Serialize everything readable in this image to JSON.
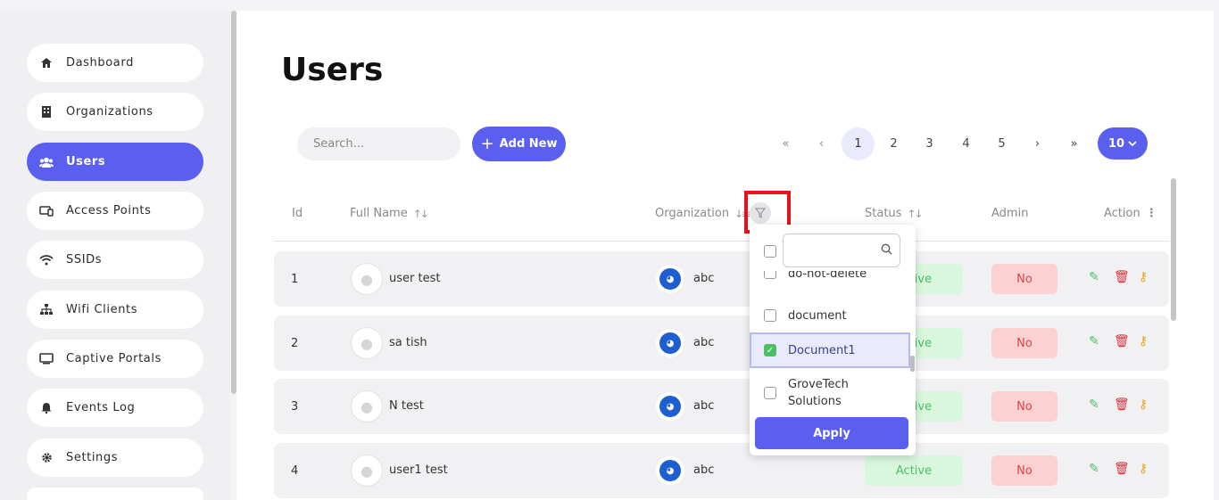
{
  "sidebar": {
    "items": [
      {
        "label": "Dashboard",
        "icon": "home-icon"
      },
      {
        "label": "Organizations",
        "icon": "building-icon"
      },
      {
        "label": "Users",
        "icon": "users-icon",
        "active": true
      },
      {
        "label": "Access Points",
        "icon": "devices-icon"
      },
      {
        "label": "SSIDs",
        "icon": "wifi-icon"
      },
      {
        "label": "Wifi Clients",
        "icon": "network-icon"
      },
      {
        "label": "Captive Portals",
        "icon": "monitor-icon"
      },
      {
        "label": "Events Log",
        "icon": "bell-icon"
      },
      {
        "label": "Settings",
        "icon": "gear-icon"
      }
    ]
  },
  "page": {
    "title": "Users",
    "search_placeholder": "Search...",
    "add_new_label": "Add New",
    "page_size": "10"
  },
  "pagination": {
    "first": "«",
    "prev": "‹",
    "pages": [
      "1",
      "2",
      "3",
      "4",
      "5"
    ],
    "current": "1",
    "next": "›",
    "last": "»"
  },
  "table": {
    "headers": {
      "id": "Id",
      "full_name": "Full Name",
      "organization": "Organization",
      "status": "Status",
      "admin": "Admin",
      "action": "Action"
    },
    "rows": [
      {
        "id": "1",
        "name": "user test",
        "org": "abc",
        "status": "Active",
        "admin": "No"
      },
      {
        "id": "2",
        "name": "sa tish",
        "org": "abc",
        "status": "Active",
        "admin": "No"
      },
      {
        "id": "3",
        "name": "N test",
        "org": "abc",
        "status": "Active",
        "admin": "No"
      },
      {
        "id": "4",
        "name": "user1 test",
        "org": "abc",
        "status": "Active",
        "admin": "No"
      }
    ]
  },
  "org_filter": {
    "search_value": "",
    "options": [
      {
        "label": "do-not-delete",
        "checked": false
      },
      {
        "label": "document",
        "checked": false
      },
      {
        "label": "Document1",
        "checked": true
      },
      {
        "label": "GroveTech Solutions",
        "checked": false
      }
    ],
    "apply_label": "Apply"
  },
  "colors": {
    "accent": "#5b5ff0",
    "status_active_bg": "#d8f7dc",
    "admin_no_bg": "#fcd1d1",
    "highlight_box": "#e5131b"
  }
}
